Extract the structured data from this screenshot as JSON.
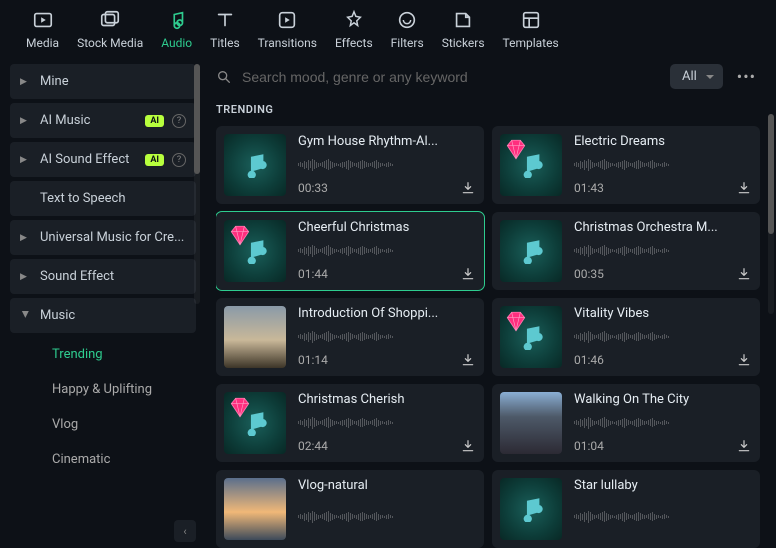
{
  "top_nav": [
    {
      "id": "media",
      "label": "Media"
    },
    {
      "id": "stock-media",
      "label": "Stock Media"
    },
    {
      "id": "audio",
      "label": "Audio",
      "active": true
    },
    {
      "id": "titles",
      "label": "Titles"
    },
    {
      "id": "transitions",
      "label": "Transitions"
    },
    {
      "id": "effects",
      "label": "Effects"
    },
    {
      "id": "filters",
      "label": "Filters"
    },
    {
      "id": "stickers",
      "label": "Stickers"
    },
    {
      "id": "templates",
      "label": "Templates"
    }
  ],
  "sidebar": {
    "items": [
      {
        "label": "Mine",
        "expandable": true
      },
      {
        "label": "AI Music",
        "expandable": true,
        "ai": true,
        "help": true
      },
      {
        "label": "AI Sound Effect",
        "expandable": true,
        "ai": true,
        "help": true
      },
      {
        "label": "Text to Speech",
        "expandable": false
      },
      {
        "label": "Universal Music for Cre...",
        "expandable": true
      },
      {
        "label": "Sound Effect",
        "expandable": true
      },
      {
        "label": "Music",
        "expandable": true,
        "expanded": true
      }
    ],
    "subitems": [
      {
        "label": "Trending",
        "active": true
      },
      {
        "label": "Happy & Uplifting"
      },
      {
        "label": "Vlog"
      },
      {
        "label": "Cinematic"
      }
    ]
  },
  "search": {
    "placeholder": "Search mood, genre or any keyword"
  },
  "filter": {
    "selected": "All"
  },
  "section_title": "TRENDING",
  "tracks": [
    {
      "title": "Gym House Rhythm-Al...",
      "duration": "00:33",
      "thumb": "audio",
      "diamond": false
    },
    {
      "title": "Electric Dreams",
      "duration": "01:43",
      "thumb": "audio",
      "diamond": true
    },
    {
      "title": "Cheerful Christmas",
      "duration": "01:44",
      "thumb": "audio",
      "diamond": true,
      "selected": true
    },
    {
      "title": "Christmas Orchestra M...",
      "duration": "00:35",
      "thumb": "audio",
      "diamond": false
    },
    {
      "title": "Introduction Of Shoppi...",
      "duration": "01:14",
      "thumb": "img-cloudy",
      "diamond": false
    },
    {
      "title": "Vitality Vibes",
      "duration": "01:46",
      "thumb": "audio",
      "diamond": true
    },
    {
      "title": "Christmas Cherish",
      "duration": "02:44",
      "thumb": "audio",
      "diamond": true
    },
    {
      "title": "Walking On The City",
      "duration": "01:04",
      "thumb": "img-rocks",
      "diamond": false
    },
    {
      "title": "Vlog-natural",
      "duration": "",
      "thumb": "img-sunset",
      "diamond": false
    },
    {
      "title": "Star lullaby",
      "duration": "",
      "thumb": "audio",
      "diamond": false
    }
  ]
}
